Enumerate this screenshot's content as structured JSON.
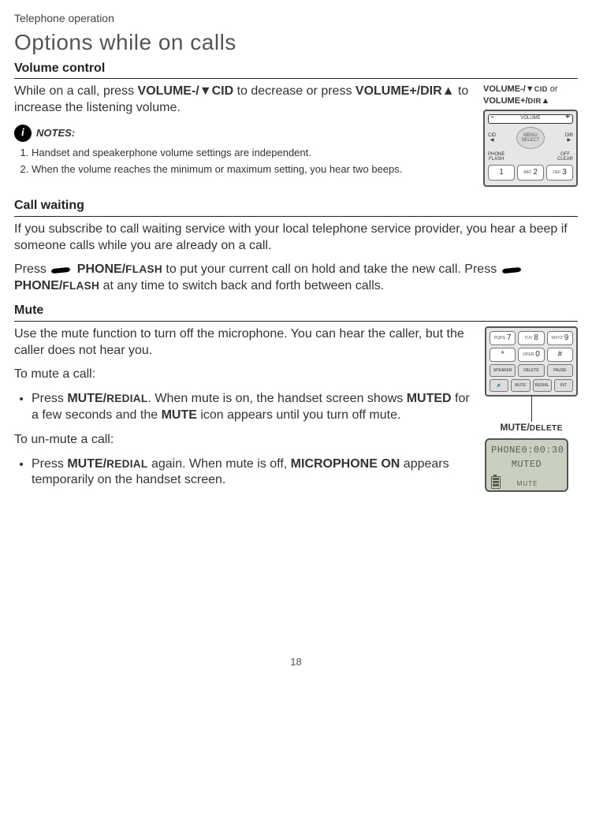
{
  "header": {
    "section": "Telephone operation",
    "title": "Options while on calls"
  },
  "volume": {
    "heading": "Volume control",
    "body_a": "While on a call, press ",
    "key_down": "VOLUME-/",
    "arrow_down": "▼",
    "key_down_suffix": "CID",
    "body_b": " to decrease or press ",
    "key_up": "VOLUME+/DIR",
    "arrow_up": "▲",
    "body_c": " to increase the listening volume.",
    "label_line1a": "VOLUME-/",
    "label_line1b": "CID",
    "label_or": " or",
    "label_line2a": "VOLUME+/",
    "label_line2b": "DIR",
    "notes_label": "NOTES:",
    "notes": [
      "Handset and speakerphone volume settings are independent.",
      "When the volume reaches the minimum or maximum setting, you hear two beeps."
    ],
    "keypad": {
      "volume": "VOLUME",
      "cid": "CID",
      "dir": "DIR",
      "phone_flash": "PHONE FLASH",
      "off_clear": "OFF CLEAR",
      "menu": "MENU",
      "select": "SELECT",
      "keys": [
        "1",
        "2",
        "3"
      ],
      "subs": [
        "",
        "ABC",
        "DEF"
      ]
    }
  },
  "callwaiting": {
    "heading": "Call waiting",
    "para1": "If you subscribe to call waiting service with your local telephone service provider, you hear a beep if someone calls while you are already on a call.",
    "p2_a": "Press ",
    "p2_key": " PHONE/",
    "p2_flash": "FLASH",
    "p2_b": " to put your current call on hold and take the new call. Press ",
    "p2_c": " at any time to switch back and forth between calls."
  },
  "mute": {
    "heading": "Mute",
    "para1": "Use the mute function to turn off the microphone. You can hear the caller, but the caller does not hear you.",
    "to_mute": "To mute a call:",
    "bullet1_a": "Press ",
    "bullet1_key": "MUTE/",
    "bullet1_redial": "REDIAL",
    "bullet1_b": ". When mute is on, the handset screen shows ",
    "bullet1_muted": "MUTED",
    "bullet1_c": " for a few seconds and the ",
    "bullet1_mute": "MUTE",
    "bullet1_d": " icon appears until you turn off mute.",
    "to_unmute": "To un-mute a call:",
    "bullet2_a": "Press ",
    "bullet2_key": "MUTE/",
    "bullet2_redial": "REDIAL",
    "bullet2_b": " again. When mute is off, ",
    "bullet2_micon": "MICROPHONE ON",
    "bullet2_c": " appears temporarily on the handset screen.",
    "keypad2": {
      "row1": [
        "7",
        "8",
        "9"
      ],
      "row1subs": [
        "PQRS",
        "TUV",
        "WXYZ"
      ],
      "row2": [
        "*",
        "0",
        "#"
      ],
      "row2subs": [
        "",
        "OPER",
        ""
      ],
      "row3": [
        "SPEAKER",
        "DELETE",
        "PAUSE"
      ],
      "row4": [
        "",
        "MUTE",
        "REDIAL",
        "INT"
      ]
    },
    "label_mute": "MUTE/",
    "label_delete": "DELETE",
    "lcd": {
      "line1_left": "PHONE",
      "line1_right": "0:00:30",
      "line2": "MUTED",
      "mute": "MUTE"
    }
  },
  "page_number": "18"
}
